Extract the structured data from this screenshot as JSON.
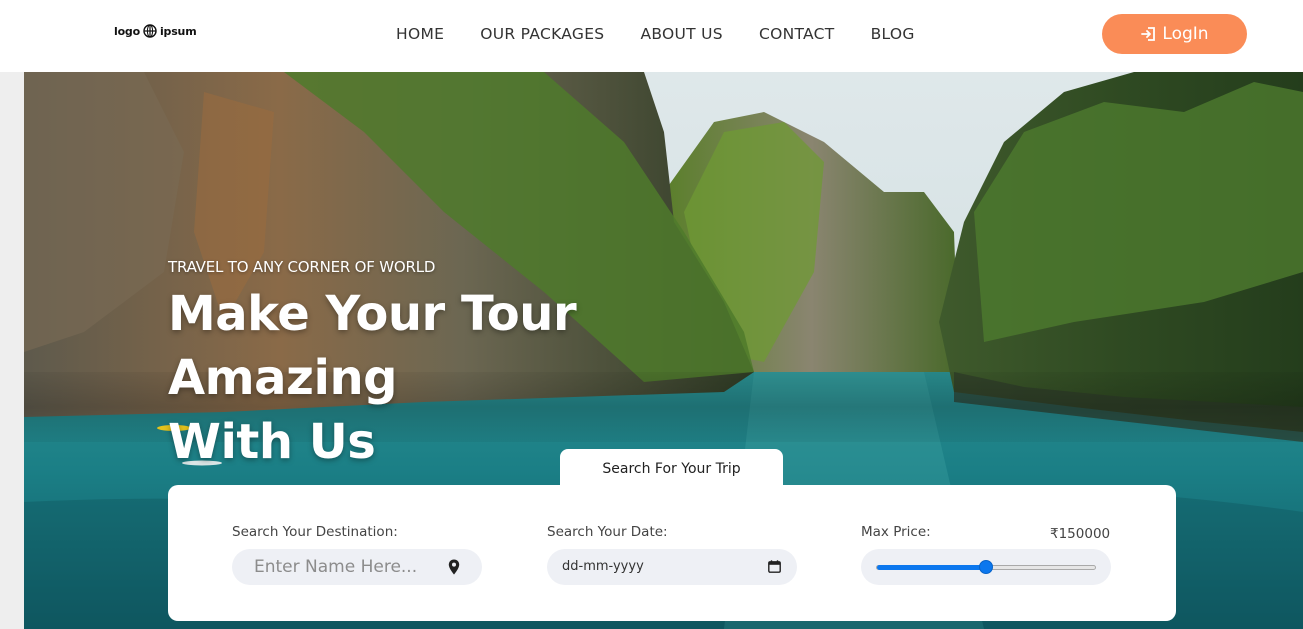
{
  "header": {
    "logo_text": "logo ipsum",
    "logo_left": "logo",
    "logo_right": "ipsum",
    "nav": [
      "HOME",
      "OUR PACKAGES",
      "ABOUT US",
      "CONTACT",
      "BLOG"
    ],
    "login_label": "LogIn",
    "login_color": "#fa8c57"
  },
  "hero": {
    "subtitle": "TRAVEL TO ANY CORNER OF WORLD",
    "title_line1": "Make Your Tour Amazing",
    "title_line2": "With Us"
  },
  "search": {
    "tab_label": "Search For Your Trip",
    "destination_label": "Search Your Destination:",
    "destination_placeholder": "Enter Name Here...",
    "date_label": "Search Your Date:",
    "date_placeholder": "dd-mm-yyyy",
    "price_label": "Max Price:",
    "price_value": "₹150000",
    "price_fraction": 0.5,
    "accent_color": "#0b77ee"
  },
  "icons": {
    "logo": "globe-icon",
    "login": "login-icon",
    "destination": "location-pin-icon",
    "date": "calendar-icon"
  }
}
